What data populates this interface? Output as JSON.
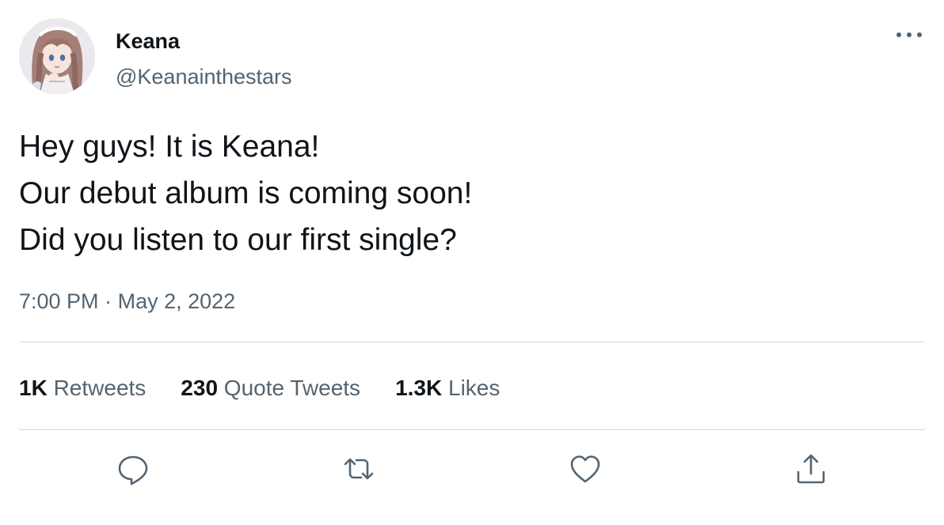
{
  "author": {
    "display_name": "Keana",
    "handle": "@Keanainthestars",
    "avatar_icon": "anime-girl-avatar"
  },
  "tweet": {
    "lines": [
      "Hey guys! It is Keana!",
      "Our debut album is coming soon!",
      "Did you listen to our first single?"
    ]
  },
  "meta": {
    "time": "7:00 PM",
    "separator": "·",
    "date": "May 2, 2022"
  },
  "stats": {
    "retweets": {
      "count": "1K",
      "label": "Retweets"
    },
    "quote_tweets": {
      "count": "230",
      "label": "Quote Tweets"
    },
    "likes": {
      "count": "1.3K",
      "label": "Likes"
    }
  },
  "actions": {
    "reply_icon": "reply-icon",
    "retweet_icon": "retweet-icon",
    "like_icon": "heart-icon",
    "share_icon": "share-icon",
    "more_icon": "more-icon"
  },
  "colors": {
    "text_primary": "#0f1419",
    "text_secondary": "#536471",
    "divider": "#cfd9de"
  }
}
